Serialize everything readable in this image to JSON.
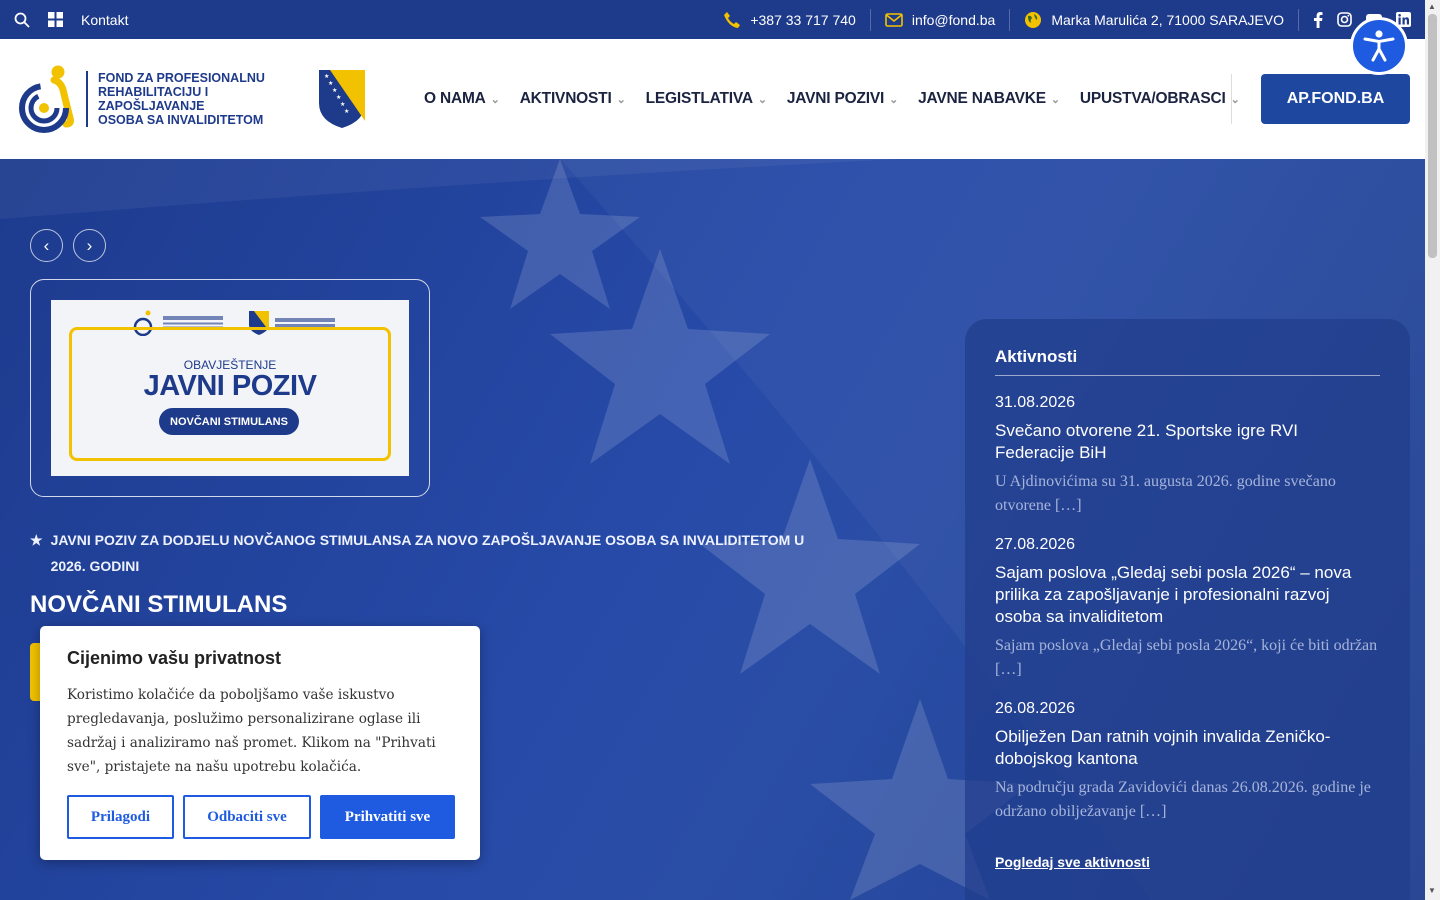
{
  "topbar": {
    "kontakt": "Kontakt",
    "phone": "+387 33 717 740",
    "email": "info@fond.ba",
    "address": "Marka Marulića 2, 71000 SARAJEVO"
  },
  "logo": {
    "line1": "FOND ZA PROFESIONALNU",
    "line2": "REHABILITACIJU I ZAPOŠLJAVANJE",
    "line3": "OSOBA SA INVALIDITETOM"
  },
  "nav": {
    "items": [
      {
        "label": "O NAMA"
      },
      {
        "label": "AKTIVNOSTI"
      },
      {
        "label": "LEGISTLATIVA"
      },
      {
        "label": "JAVNI POZIVI"
      },
      {
        "label": "JAVNE NABAVKE"
      },
      {
        "label": "UPUSTVA/OBRASCI"
      }
    ],
    "cta": "AP.FOND.BA"
  },
  "slider": {
    "image": {
      "subtitle": "OBAVJEŠTENJE",
      "title": "JAVNI POZIV",
      "pill": "NOVČANI STIMULANS"
    },
    "headline": "JAVNI POZIV ZA DODJELU NOVČANOG STIMULANSA ZA NOVO ZAPOŠLJAVANJE OSOBA SA INVALIDITETOM U 2026. GODINI",
    "title": "NOVČANI STIMULANS"
  },
  "aktivnosti": {
    "heading": "Aktivnosti",
    "items": [
      {
        "date": "31.08.2026",
        "title": "Svečano otvorene 21. Sportske igre RVI Federacije BiH",
        "excerpt": " U Ajdinovićima su 31. augusta 2026. godine svečano otvorene […]"
      },
      {
        "date": "27.08.2026",
        "title": "Sajam poslova „Gledaj sebi posla 2026“ – nova prilika za zapošljavanje i profesionalni razvoj osoba sa invaliditetom",
        "excerpt": "Sajam poslova „Gledaj sebi posla 2026“, koji će biti održan […]"
      },
      {
        "date": "26.08.2026",
        "title": "Obilježen Dan ratnih vojnih invalida Zeničko-dobojskog kantona",
        "excerpt": "Na području grada Zavidovići danas 26.08.2026. godine je održano obilježavanje […]"
      }
    ],
    "see_all": "Pogledaj sve aktivnosti"
  },
  "cookie": {
    "title": "Cijenimo vašu privatnost",
    "text": "Koristimo kolačiće da poboljšamo vaše iskustvo pregledavanja, poslužimo personalizirane oglase ili sadržaj i analiziramo naš promet. Klikom na \"Prihvati sve\", pristajete na našu upotrebu kolačića.",
    "customize": "Prilagodi",
    "reject": "Odbaciti sve",
    "accept": "Prihvatiti sve"
  },
  "colors": {
    "brand_blue": "#1e3a8a",
    "accent_yellow": "#f2c200",
    "button_blue": "#1e5be0"
  }
}
